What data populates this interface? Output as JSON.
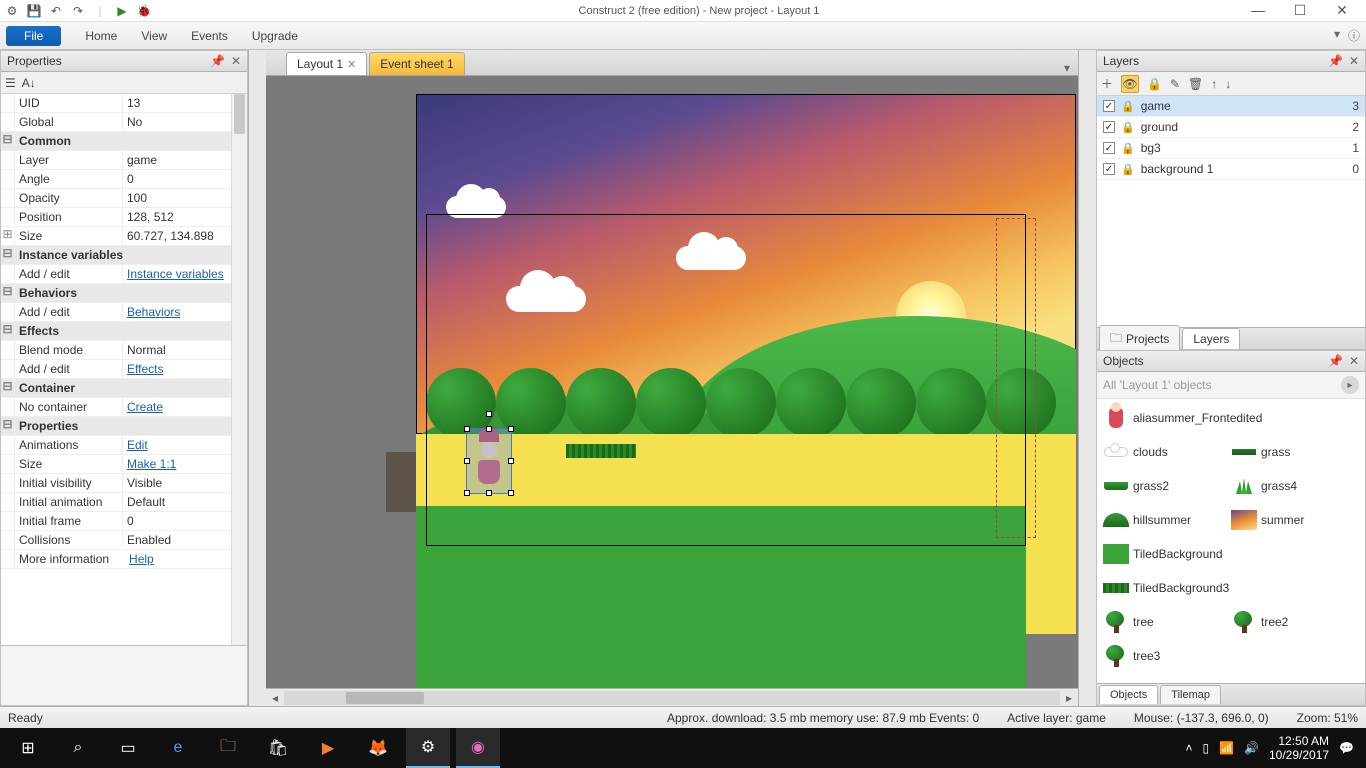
{
  "window": {
    "title": "Construct 2  (free edition) - New project - Layout 1"
  },
  "menu": {
    "file": "File",
    "items": [
      "Home",
      "View",
      "Events",
      "Upgrade"
    ]
  },
  "tabs": {
    "layout": "Layout 1",
    "events": "Event sheet 1"
  },
  "properties_panel": {
    "title": "Properties",
    "more_info_label": "More information",
    "help": "Help",
    "rows": [
      {
        "k": "UID",
        "v": "13"
      },
      {
        "k": "Global",
        "v": "No"
      },
      {
        "group": "Common"
      },
      {
        "k": "Layer",
        "v": "game"
      },
      {
        "k": "Angle",
        "v": "0"
      },
      {
        "k": "Opacity",
        "v": "100"
      },
      {
        "k": "Position",
        "v": "128, 512"
      },
      {
        "k": "Size",
        "v": "60.727, 134.898",
        "expand": true
      },
      {
        "group": "Instance variables"
      },
      {
        "k": "Add / edit",
        "v": "Instance variables",
        "link": true
      },
      {
        "group": "Behaviors"
      },
      {
        "k": "Add / edit",
        "v": "Behaviors",
        "link": true
      },
      {
        "group": "Effects"
      },
      {
        "k": "Blend mode",
        "v": "Normal"
      },
      {
        "k": "Add / edit",
        "v": "Effects",
        "link": true
      },
      {
        "group": "Container"
      },
      {
        "k": "No container",
        "v": "Create",
        "link": true
      },
      {
        "group": "Properties"
      },
      {
        "k": "Animations",
        "v": "Edit",
        "link": true
      },
      {
        "k": "Size",
        "v": "Make 1:1",
        "link": true
      },
      {
        "k": "Initial visibility",
        "v": "Visible"
      },
      {
        "k": "Initial animation",
        "v": "Default"
      },
      {
        "k": "Initial frame",
        "v": "0"
      },
      {
        "k": "Collisions",
        "v": "Enabled"
      }
    ]
  },
  "layers_panel": {
    "title": "Layers",
    "rows": [
      {
        "name": "game",
        "n": "3",
        "sel": true
      },
      {
        "name": "ground",
        "n": "2"
      },
      {
        "name": "bg3",
        "n": "1"
      },
      {
        "name": "background 1",
        "n": "0"
      }
    ],
    "right_tabs": [
      "Projects",
      "Layers"
    ]
  },
  "objects_panel": {
    "title": "Objects",
    "filter": "All 'Layout 1' objects",
    "items": [
      {
        "name": "aliasummer_Frontedited",
        "wide": true,
        "icon": "char"
      },
      {
        "name": "clouds",
        "icon": "cloud"
      },
      {
        "name": "grass",
        "icon": "grass"
      },
      {
        "name": "grass2",
        "icon": "grass2"
      },
      {
        "name": "grass4",
        "icon": "grass4"
      },
      {
        "name": "hillsummer",
        "icon": "hill"
      },
      {
        "name": "summer",
        "icon": "summer"
      },
      {
        "name": "TiledBackground",
        "wide": true,
        "icon": "tbg"
      },
      {
        "name": "TiledBackground3",
        "wide": true,
        "icon": "tbg3"
      },
      {
        "name": "tree",
        "icon": "tree"
      },
      {
        "name": "tree2",
        "icon": "tree2"
      },
      {
        "name": "tree3",
        "icon": "tree3"
      }
    ],
    "bottom_tabs": [
      "Objects",
      "Tilemap"
    ]
  },
  "status": {
    "ready": "Ready",
    "download": "Approx. download: 3.5 mb   memory use: 87.9 mb   Events: 0",
    "active_layer": "Active layer: game",
    "mouse": "Mouse: (-137.3, 696.0, 0)",
    "zoom": "Zoom: 51%"
  },
  "taskbar": {
    "time": "12:50 AM",
    "date": "10/29/2017"
  }
}
